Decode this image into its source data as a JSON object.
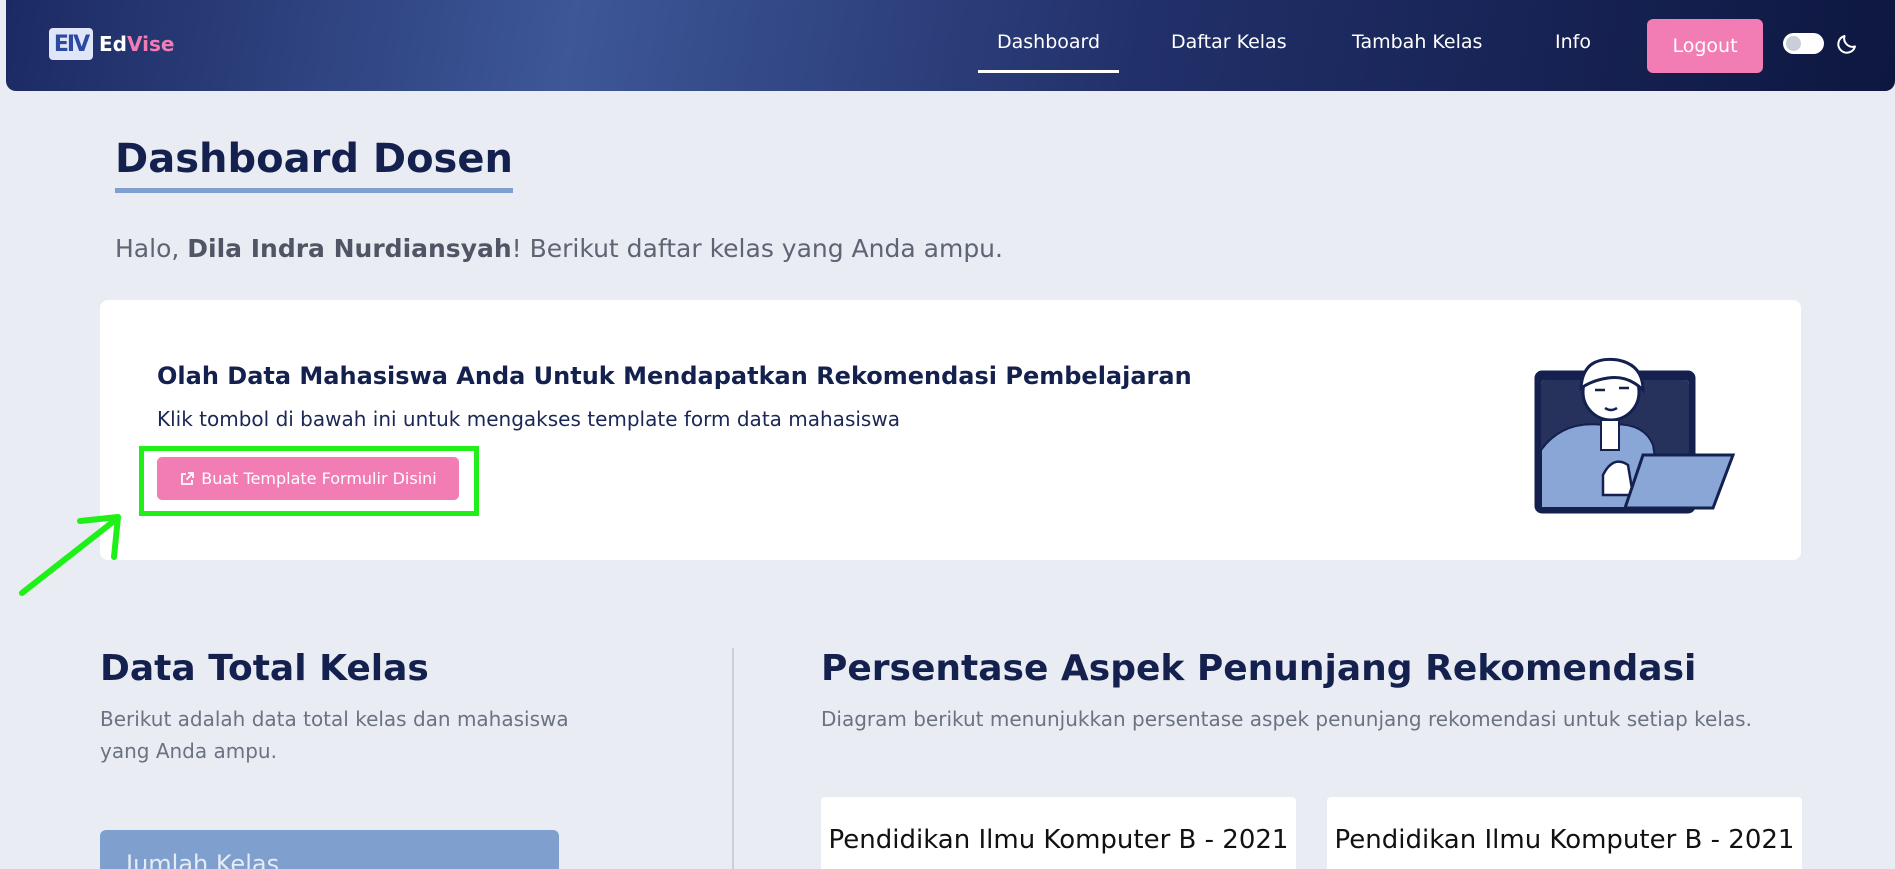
{
  "brand": {
    "mark": "EIV",
    "name_prefix": "Ed",
    "name_suffix": "Vise"
  },
  "nav": {
    "items": [
      "Dashboard",
      "Daftar Kelas",
      "Tambah Kelas",
      "Info"
    ],
    "active": "Dashboard",
    "logout": "Logout"
  },
  "page": {
    "title": "Dashboard Dosen",
    "greeting_prefix": "Halo, ",
    "user_name": "Dila Indra Nurdiansyah",
    "greeting_suffix": "! Berikut daftar kelas yang Anda ampu."
  },
  "promo_card": {
    "title": "Olah Data Mahasiswa Anda Untuk Mendapatkan Rekomendasi Pembelajaran",
    "subtitle": "Klik tombol di bawah ini untuk mengakses template form data mahasiswa",
    "button_label": "Buat Template Formulir Disini"
  },
  "total_section": {
    "title": "Data Total Kelas",
    "description": "Berikut adalah data total kelas dan mahasiswa yang Anda ampu.",
    "stat_label": "Jumlah Kelas"
  },
  "aspect_section": {
    "title": "Persentase Aspek Penunjang Rekomendasi",
    "description": "Diagram berikut menunjukkan persentase aspek penunjang rekomendasi untuk setiap kelas.",
    "classes": [
      "Pendidikan Ilmu Komputer B - 2021",
      "Pendidikan Ilmu Komputer B - 2021"
    ]
  },
  "colors": {
    "accent_pink": "#f27cb4",
    "navy": "#14204e",
    "highlight_green": "#1ef018",
    "stat_blue": "#7fa0ce"
  }
}
